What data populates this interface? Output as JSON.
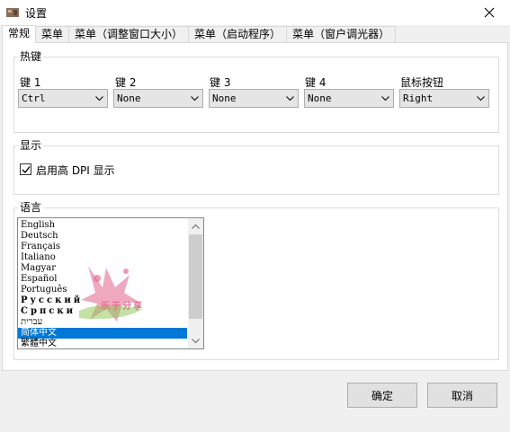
{
  "window": {
    "title": "设置",
    "close_glyph": "✕"
  },
  "tabs": [
    {
      "label": "常规",
      "active": true
    },
    {
      "label": "菜单",
      "active": false
    },
    {
      "label": "菜单（调整窗口大小）",
      "active": false
    },
    {
      "label": "菜单（启动程序）",
      "active": false
    },
    {
      "label": "菜单（窗户调光器）",
      "active": false
    }
  ],
  "hotkeys": {
    "group_title": "热键",
    "fields": [
      {
        "label": "键 1",
        "value": "Ctrl"
      },
      {
        "label": "键 2",
        "value": "None"
      },
      {
        "label": "键 3",
        "value": "None"
      },
      {
        "label": "键 4",
        "value": "None"
      },
      {
        "label": "鼠标按钮",
        "value": "Right"
      }
    ]
  },
  "display": {
    "group_title": "显示",
    "checkbox_label": "启用高 DPI 显示",
    "checked": true
  },
  "language": {
    "group_title": "语言",
    "items": [
      "English",
      "Deutsch",
      "Français",
      "Italiano",
      "Magyar",
      "Español",
      "Português",
      "Русский",
      "Српски",
      "עברית",
      "简体中文",
      "繁體中文"
    ],
    "selected_index": 10
  },
  "watermark_text": "乐于分享",
  "buttons": {
    "ok": "确定",
    "cancel": "取消"
  },
  "colors": {
    "selection": "#0078d7",
    "watermark_pink": "#e0567f",
    "watermark_green": "#7fbf3f"
  }
}
